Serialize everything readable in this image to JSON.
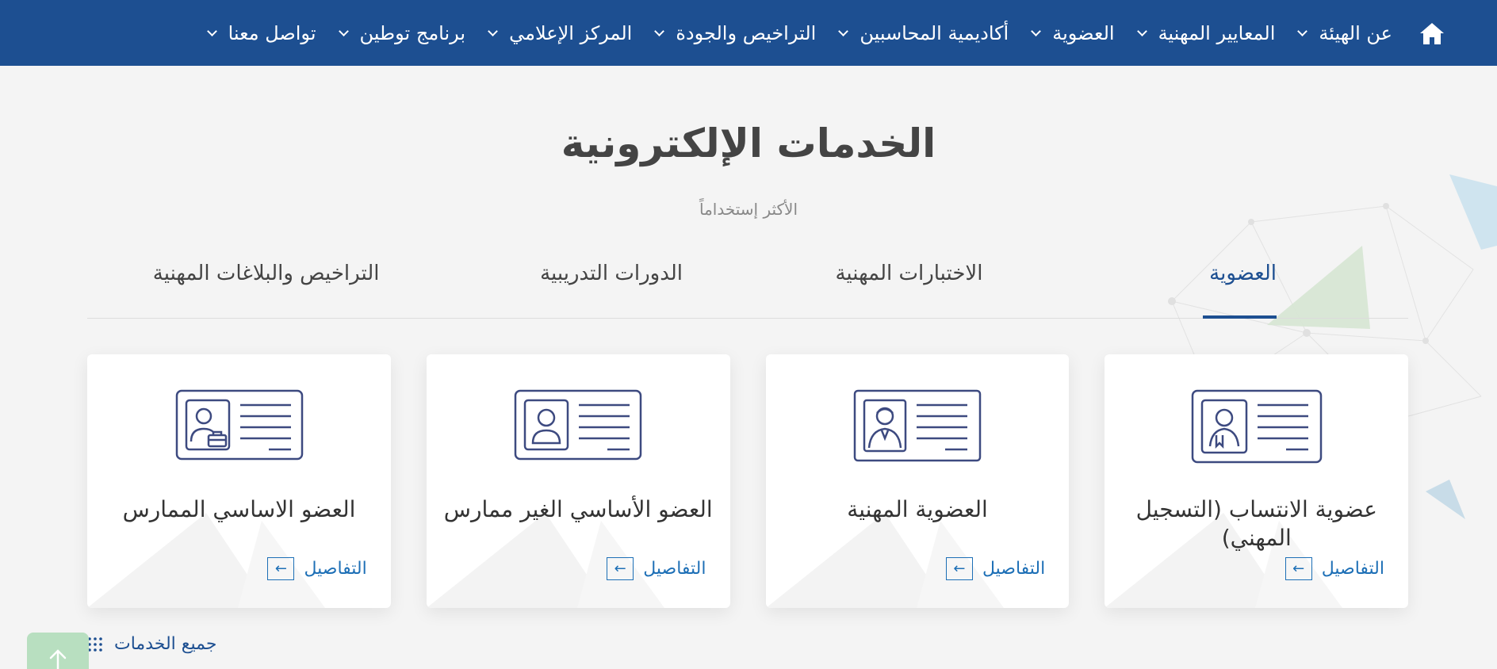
{
  "nav": {
    "items": [
      {
        "label": "عن الهيئة"
      },
      {
        "label": "المعايير المهنية"
      },
      {
        "label": "العضوية"
      },
      {
        "label": "أكاديمية المحاسبين"
      },
      {
        "label": "التراخيص والجودة"
      },
      {
        "label": "المركز الإعلامي"
      },
      {
        "label": "برنامج توطين"
      },
      {
        "label": "تواصل معنا"
      }
    ],
    "home_icon": "home-icon",
    "chevron_icon": "chevron-down-icon"
  },
  "page": {
    "title": "الخدمات الإلكترونية",
    "subtitle": "الأكثر إستخداماً"
  },
  "tabs": [
    {
      "label": "العضوية",
      "active": true
    },
    {
      "label": "الاختبارات المهنية",
      "active": false
    },
    {
      "label": "الدورات التدريبية",
      "active": false
    },
    {
      "label": "التراخيص والبلاغات المهنية",
      "active": false
    }
  ],
  "cards": [
    {
      "title": "عضوية الانتساب (التسجيل المهني)",
      "details_label": "التفاصيل",
      "icon": "id-card-certificate-icon"
    },
    {
      "title": "العضوية المهنية",
      "details_label": "التفاصيل",
      "icon": "id-card-professional-icon"
    },
    {
      "title": "العضو الأساسي الغير ممارس",
      "details_label": "التفاصيل",
      "icon": "id-card-person-icon"
    },
    {
      "title": "العضو الاساسي الممارس",
      "details_label": "التفاصيل",
      "icon": "id-card-briefcase-icon"
    }
  ],
  "footer": {
    "all_services_label": "جميع الخدمات",
    "scroll_top_icon": "arrow-up-icon"
  },
  "colors": {
    "primary": "#1d4f91",
    "link": "#1d6fb6",
    "background": "#f4f4f4",
    "scroll_button": "#b8dfc0"
  }
}
